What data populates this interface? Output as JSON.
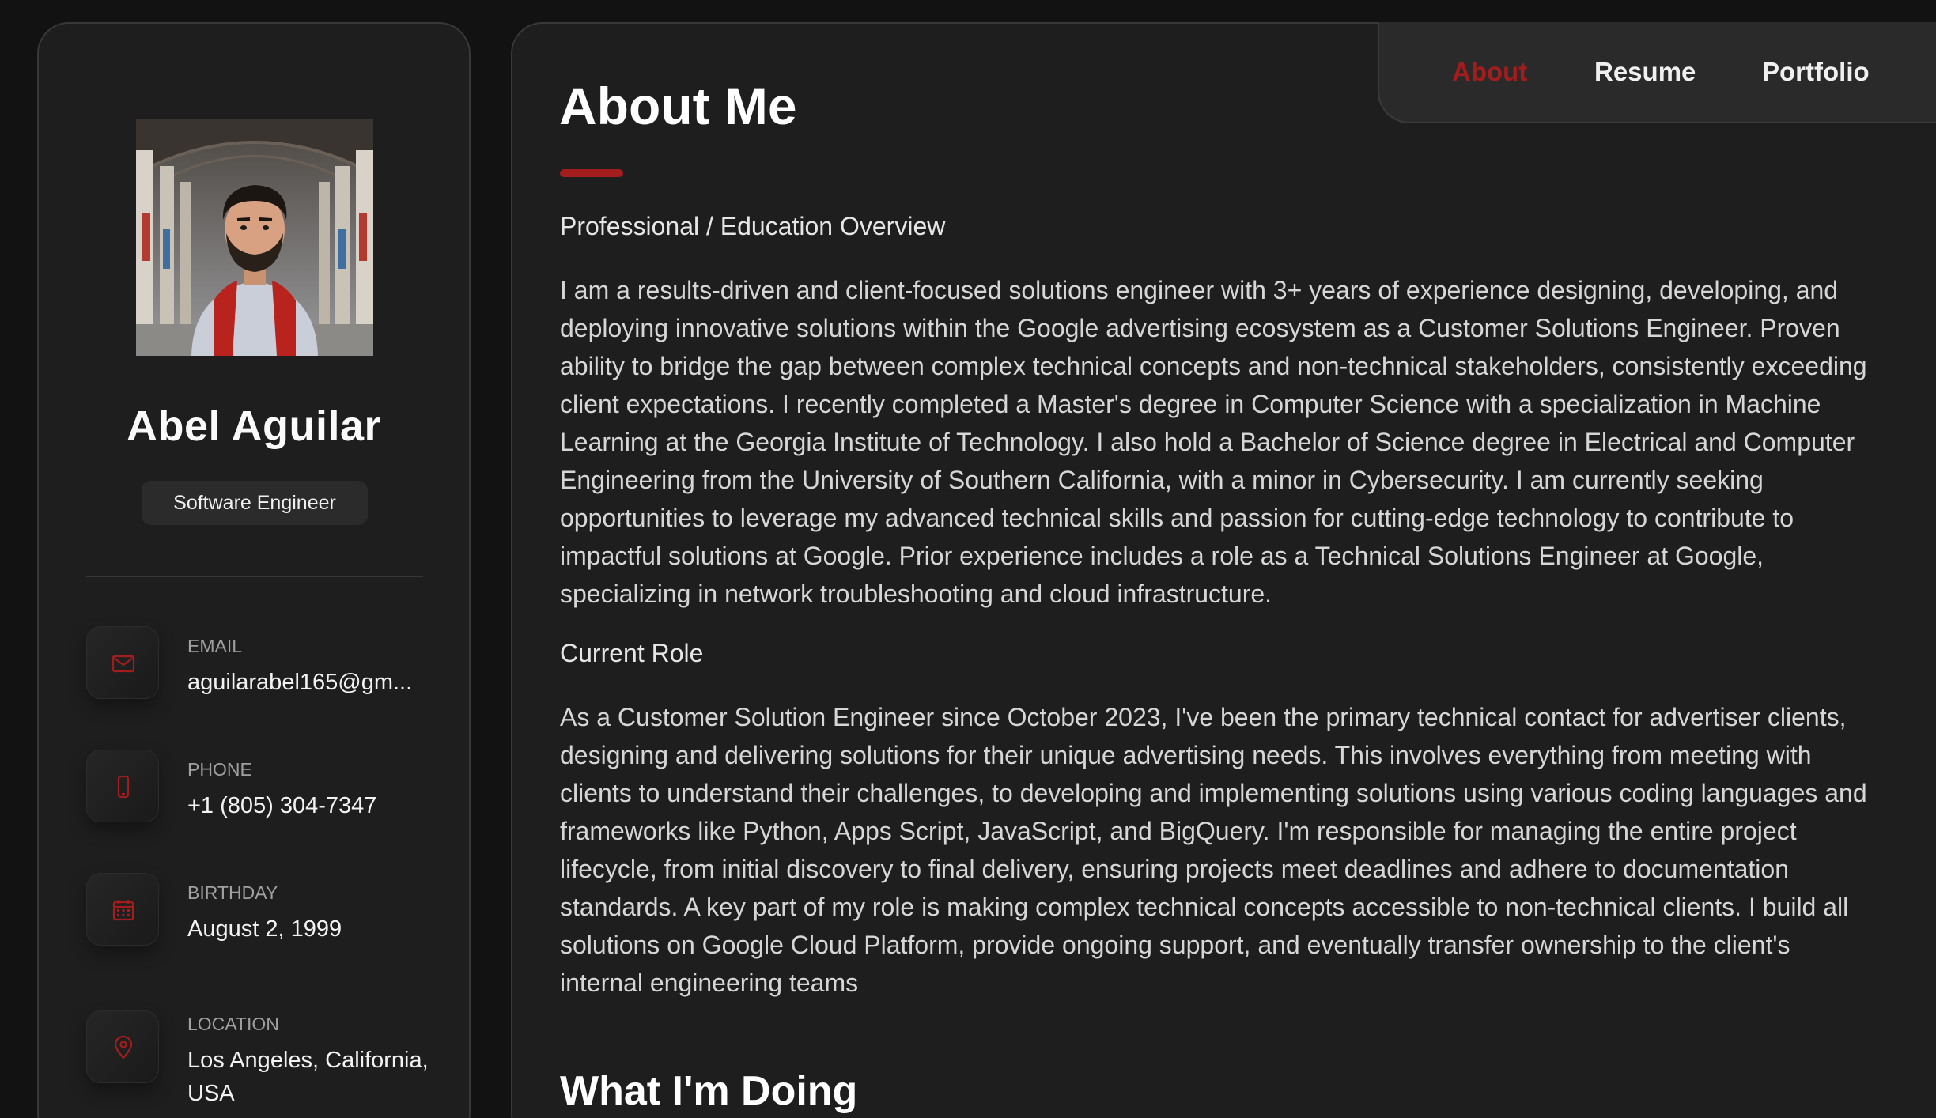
{
  "sidebar": {
    "name": "Abel Aguilar",
    "title": "Software Engineer",
    "contacts": [
      {
        "label": "EMAIL",
        "value": "aguilarabel165@gm...",
        "icon": "mail-icon"
      },
      {
        "label": "PHONE",
        "value": "+1 (805) 304-7347",
        "icon": "phone-icon"
      },
      {
        "label": "BIRTHDAY",
        "value": "August 2, 1999",
        "icon": "calendar-icon"
      },
      {
        "label": "LOCATION",
        "value": "Los Angeles, California, USA",
        "icon": "location-pin-icon"
      }
    ]
  },
  "nav": {
    "items": [
      {
        "label": "About",
        "active": true
      },
      {
        "label": "Resume",
        "active": false
      },
      {
        "label": "Portfolio",
        "active": false
      }
    ]
  },
  "article": {
    "title": "About Me",
    "overview_label": "Professional / Education Overview",
    "overview_text": "I am a results-driven and client-focused solutions engineer with 3+ years of experience designing, developing, and deploying innovative solutions within the Google advertising ecosystem as a Customer Solutions Engineer. Proven ability to bridge the gap between complex technical concepts and non-technical stakeholders, consistently exceeding client expectations. I recently completed a Master's degree in Computer Science with a specialization in Machine Learning at the Georgia Institute of Technology. I also hold a Bachelor of Science degree in Electrical and Computer Engineering from the University of Southern California, with a minor in Cybersecurity. I am currently seeking opportunities to leverage my advanced technical skills and passion for cutting-edge technology to contribute to impactful solutions at Google. Prior experience includes a role as a Technical Solutions Engineer at Google, specializing in network troubleshooting and cloud infrastructure.",
    "current_role_label": "Current Role",
    "current_role_text": "As a Customer Solution Engineer since October 2023, I've been the primary technical contact for advertiser clients, designing and delivering solutions for their unique advertising needs. This involves everything from meeting with clients to understand their challenges, to developing and implementing solutions using various coding languages and frameworks like Python, Apps Script, JavaScript, and BigQuery. I'm responsible for managing the entire project lifecycle, from initial discovery to final delivery, ensuring projects meet deadlines and adhere to documentation standards. A key part of my role is making complex technical concepts accessible to non-technical clients. I build all solutions on Google Cloud Platform, provide ongoing support, and eventually transfer ownership to the client's internal engineering teams",
    "doing_heading": "What I'm Doing"
  },
  "colors": {
    "accent": "#a31d1d",
    "background": "#121212",
    "card": "#1e1e1f"
  }
}
